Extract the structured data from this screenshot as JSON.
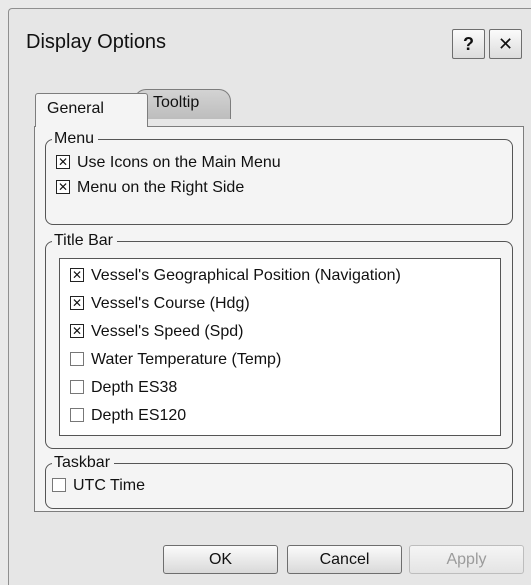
{
  "dialog": {
    "title": "Display Options",
    "help_label": "?",
    "close_label": "✕"
  },
  "tabs": [
    {
      "label": "General",
      "selected": true
    },
    {
      "label": "Tooltip",
      "selected": false
    }
  ],
  "groups": {
    "menu": {
      "title": "Menu",
      "items": [
        {
          "label": "Use Icons on the Main Menu",
          "checked": true,
          "mark": "✕"
        },
        {
          "label": "Menu on the Right Side",
          "checked": true,
          "mark": "✕"
        }
      ]
    },
    "title_bar": {
      "title": "Title Bar",
      "items": [
        {
          "label": "Vessel's Geographical Position (Navigation)",
          "checked": true,
          "mark": "✕"
        },
        {
          "label": "Vessel's Course (Hdg)",
          "checked": true,
          "mark": "✕"
        },
        {
          "label": "Vessel's Speed (Spd)",
          "checked": true,
          "mark": "✕"
        },
        {
          "label": "Water Temperature (Temp)",
          "checked": false,
          "mark": ""
        },
        {
          "label": "Depth ES38",
          "checked": false,
          "mark": ""
        },
        {
          "label": "Depth ES120",
          "checked": false,
          "mark": ""
        }
      ]
    },
    "taskbar": {
      "title": "Taskbar",
      "items": [
        {
          "label": "UTC Time",
          "checked": false,
          "mark": ""
        }
      ]
    }
  },
  "buttons": {
    "ok": "OK",
    "cancel": "Cancel",
    "apply": "Apply",
    "apply_enabled": false
  }
}
